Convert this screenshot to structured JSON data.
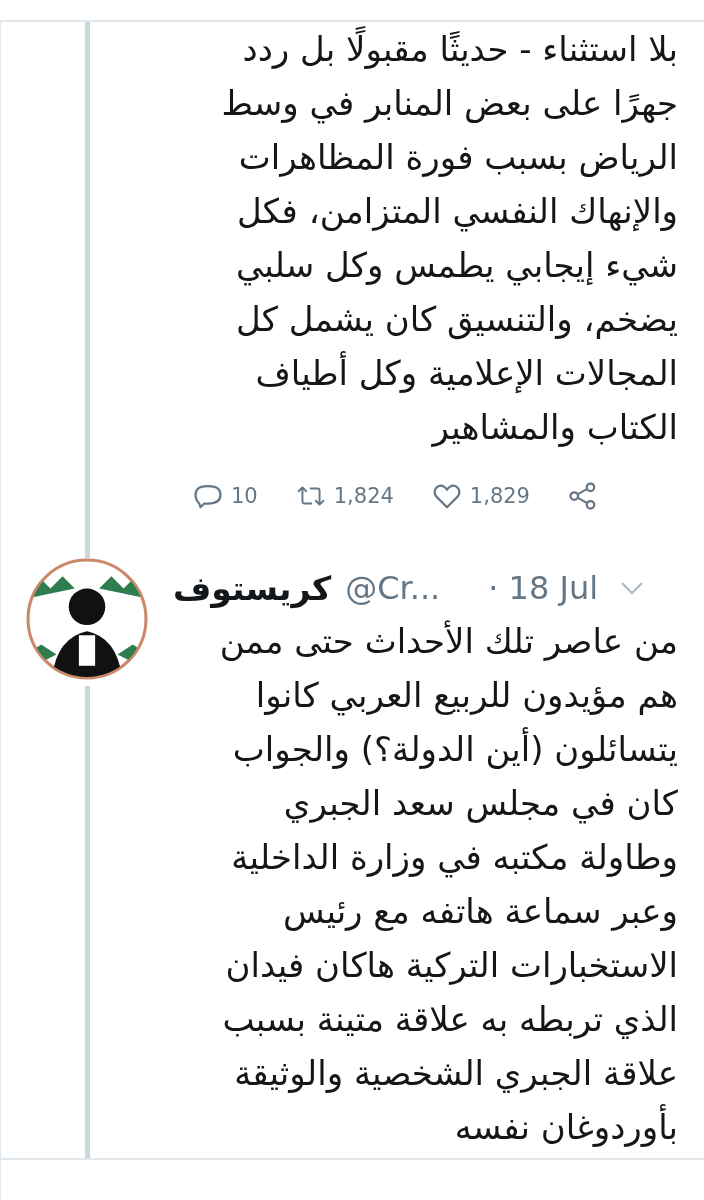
{
  "tweets": [
    {
      "kind": "continuation",
      "body_lines": [
        "بلا استثناء - حديثًا مقبولًا بل ردد",
        "جهرًا على بعض المنابر في وسط",
        "الرياض بسبب فورة المظاهرات",
        "والإنهاك النفسي المتزامن، فكل",
        "شيء إيجابي يطمس وكل سلبي",
        "يضخم، والتنسيق كان يشمل كل",
        "المجالات الإعلامية وكل أطياف",
        "الكتاب والمشاهير"
      ],
      "actions": {
        "replies": "10",
        "retweets": "1,824",
        "likes": "1,829"
      }
    },
    {
      "kind": "reply",
      "author": {
        "name": "كريستوف",
        "handle": "@Cr...",
        "date": "· 18 Jul"
      },
      "body_lines": [
        "من عاصر تلك الأحداث حتى ممن",
        "هم مؤيدون للربيع العربي كانوا",
        "يتسائلون (أين الدولة؟) والجواب",
        "كان في مجلس سعد الجبري",
        "وطاولة مكتبه في وزارة الداخلية",
        "وعبر سماعة هاتفه مع رئيس",
        "الاستخبارات التركية هاكان فيدان",
        "الذي تربطه به علاقة متينة بسبب",
        "علاقة الجبري الشخصية والوثيقة",
        "بأوردوغان نفسه"
      ]
    }
  ]
}
